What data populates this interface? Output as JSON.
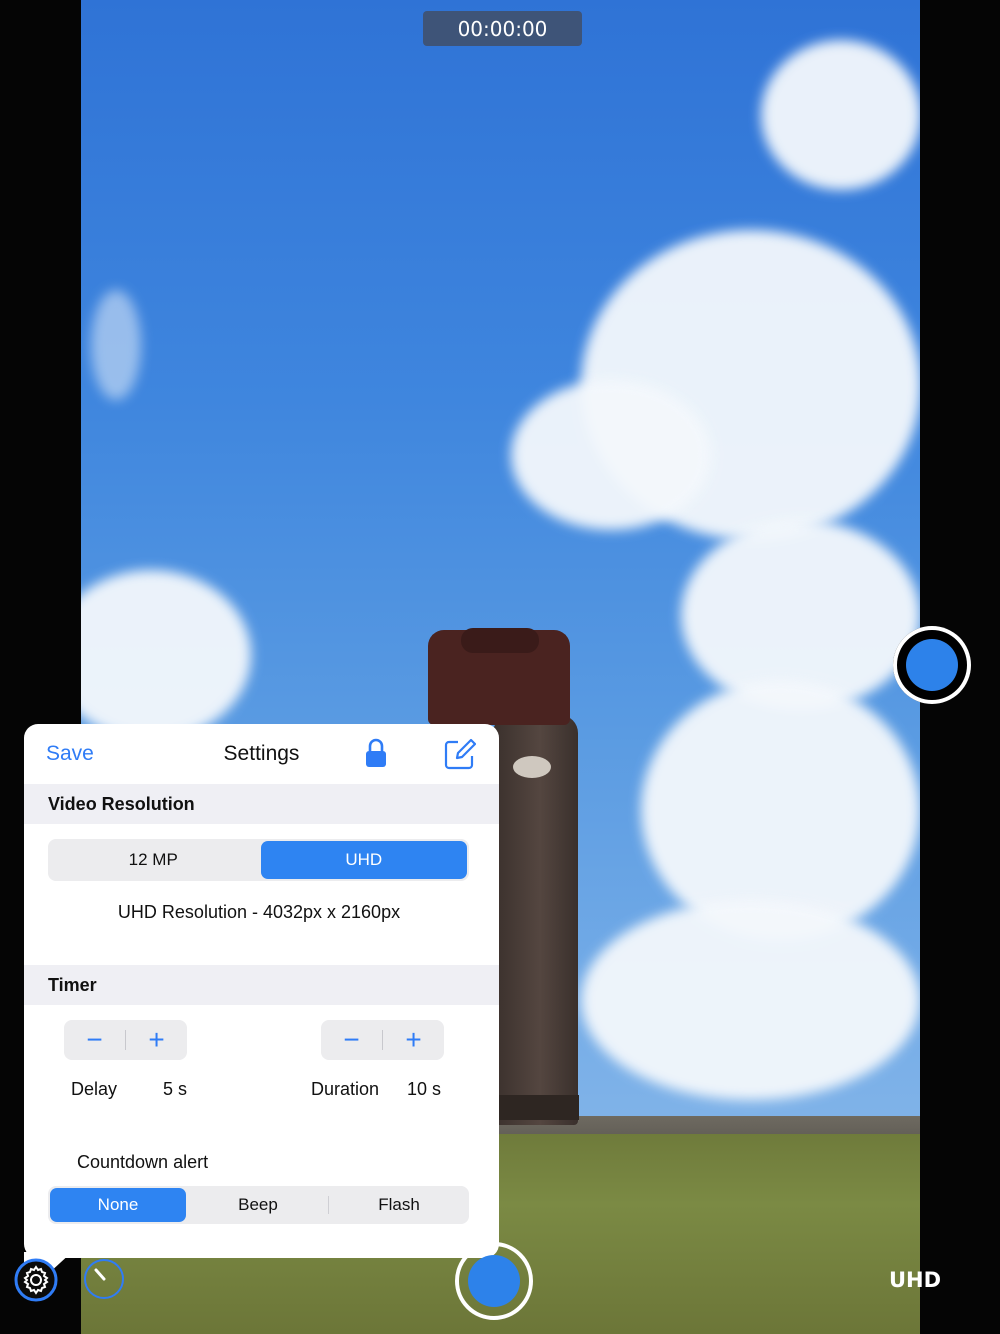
{
  "recording": {
    "elapsed": "00:00:00"
  },
  "bottom_bar": {
    "quality_badge": "UHD"
  },
  "popover": {
    "save_label": "Save",
    "title": "Settings",
    "video_resolution": {
      "header": "Video Resolution",
      "options": [
        "12 MP",
        "UHD"
      ],
      "selected": "UHD",
      "caption": "UHD Resolution - 4032px x 2160px"
    },
    "timer": {
      "header": "Timer",
      "delay_label": "Delay",
      "delay_value": "5 s",
      "duration_label": "Duration",
      "duration_value": "10 s",
      "minus": "−",
      "plus": "+",
      "countdown_label": "Countdown alert",
      "countdown_options": [
        "None",
        "Beep",
        "Flash"
      ],
      "countdown_selected": "None"
    }
  },
  "colors": {
    "accent": "#2f7cf6",
    "segment_selected": "#2e84f2",
    "shutter": "#2d82ea"
  }
}
